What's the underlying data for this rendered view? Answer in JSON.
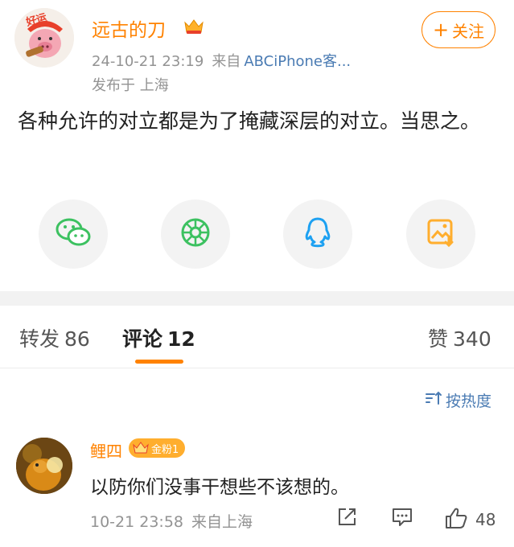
{
  "post": {
    "author": "远古的刀",
    "time": "24-10-21 23:19",
    "source_prefix": "来自",
    "client": "ABCiPhone客...",
    "location": "发布于 上海",
    "follow_plus": "+",
    "follow_label": "关注",
    "text": "各种允许的对立都是为了掩藏深层的对立。当思之。",
    "avatar_text": "好运"
  },
  "share": {
    "icons": [
      "wechat-icon",
      "moments-icon",
      "qq-icon",
      "save-image-icon"
    ],
    "colors": {
      "wechat": "#3cc160",
      "moments": "#3cc160",
      "qq": "#1da1f2",
      "save": "#ffae2e"
    }
  },
  "tabs": {
    "repost_label": "转发",
    "repost_count": "86",
    "comment_label": "评论",
    "comment_count": "12",
    "like_label": "赞",
    "like_count": "340"
  },
  "sort": {
    "label": "按热度"
  },
  "comments": [
    {
      "name": "鲤四",
      "badge": "金粉1",
      "text": "以防你们没事干想些不该想的。",
      "time": "10-21 23:58",
      "source": "来自上海",
      "likes": "48"
    }
  ],
  "colors": {
    "accent": "#ff8200",
    "link": "#4a7bb3",
    "muted": "#939393"
  }
}
